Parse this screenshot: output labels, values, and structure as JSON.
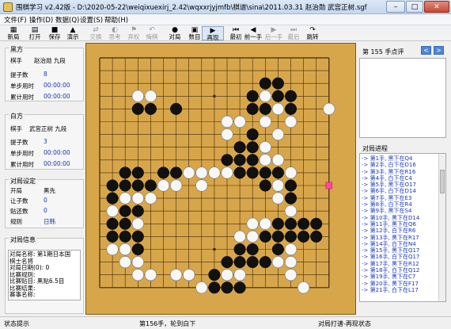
{
  "titlebar": {
    "title": "围棋学习 v2.42版 - D:\\2020-05-22\\weiqixuexirj_2.42\\wqxxrjyjmfb\\棋谱\\sina\\2011.03.31 赵治勋 武宫正树.sgf",
    "minimize": "–",
    "maximize": "□",
    "close": "✕"
  },
  "menu": [
    "文件(F)",
    "操作(D)",
    "数据(Q)",
    "设置(S)",
    "帮助(H)"
  ],
  "toolbar": [
    {
      "label": "新局",
      "icon": "▦",
      "state": "normal"
    },
    {
      "label": "打开",
      "icon": "▤",
      "state": "normal"
    },
    {
      "label": "保存",
      "icon": "■",
      "state": "normal"
    },
    {
      "label": "演示",
      "icon": "▲",
      "state": "normal"
    },
    {
      "label": "交换",
      "icon": "⇄",
      "state": "disabled"
    },
    {
      "label": "思考",
      "icon": "◐",
      "state": "disabled"
    },
    {
      "label": "弃权",
      "icon": "⚑",
      "state": "disabled"
    },
    {
      "label": "悔棋",
      "icon": "↶",
      "state": "disabled"
    },
    {
      "label": "对局",
      "icon": "●",
      "state": "normal"
    },
    {
      "label": "数目",
      "icon": "▣",
      "state": "normal"
    },
    {
      "label": "再现",
      "icon": "▶",
      "state": "pressed"
    },
    {
      "label": "最初",
      "icon": "⏮",
      "state": "normal"
    },
    {
      "label": "前一手",
      "icon": "◀",
      "state": "normal"
    },
    {
      "label": "后一手",
      "icon": "▶",
      "state": "disabled"
    },
    {
      "label": "最后",
      "icon": "⏭",
      "state": "disabled"
    },
    {
      "label": "跳转",
      "icon": "↷",
      "state": "normal"
    }
  ],
  "black": {
    "title": "黑方",
    "player_label": "棋手",
    "player": "赵治勋 九段",
    "captures_label": "提子数",
    "captures": "8",
    "time_per_move_label": "单步用时",
    "time_per_move": "00:00:00",
    "total_time_label": "累计用时",
    "total_time": "00:00:00"
  },
  "white": {
    "title": "白方",
    "player_label": "棋手",
    "player": "武宫正树 九段",
    "captures_label": "提子数",
    "captures": "3",
    "time_per_move_label": "单步用时",
    "time_per_move": "00:00:00",
    "total_time_label": "累计用时",
    "total_time": "00:00:00"
  },
  "settings": {
    "title": "对局设定",
    "first_label": "开局",
    "first": "黑先",
    "handicap_label": "让子数",
    "handicap": "0",
    "komi_label": "贴还数",
    "komi": "0",
    "rules_label": "规则",
    "rules": "日韩"
  },
  "game_info": {
    "title": "对局信息",
    "lines": [
      "对局名称: 第1期日本国",
      "棋士名将",
      "对局日期(0): 0",
      "比赛规则:",
      "比赛贴目: 黑贴6.5目",
      "比赛结果:",
      "赛事名称:"
    ]
  },
  "comment": {
    "title": "第 155 手点评",
    "prev": "<",
    "next": ">"
  },
  "process": {
    "title": "对局进程",
    "moves": [
      "-> 第1手, 黑下在Q4",
      "-> 第2手, 白下在D16",
      "-> 第3手, 黑下在R16",
      "-> 第4手, 白下在C4",
      "-> 第5手, 黑下在O17",
      "-> 第6手, 白下在D14",
      "-> 第7手, 黑下在E3",
      "-> 第8手, 白下在R4",
      "-> 第9手, 黑下在S4",
      "-> 第10手, 黑下在D14",
      "-> 第11手, 黑下在Q6",
      "-> 第12手, 白下在R6",
      "-> 第13手, 黑下在R17",
      "-> 第14手, 白下在N4",
      "-> 第15手, 黑下在Q17",
      "-> 第16手, 白下在Q17",
      "-> 第17手, 黑下在R12",
      "-> 第18手, 白下在Q12",
      "-> 第19手, 黑下在C7",
      "-> 第20手, 黑下在F17",
      "-> 第21手, 白下在L17"
    ]
  },
  "board": {
    "size": 19,
    "background": "#d8a64a",
    "rows": [
      "...................",
      "...................",
      ".............BB....",
      "...WW.......BWBB...",
      "...BB.B.....BBWB..W",
      "..........WW.W.W...",
      "..........W.B.W....",
      "...........BBW.....",
      "..........BBBWW....",
      "..BB.BBWWWWBBBBW...",
      ".BBBBWW.W....BWB...",
      ".BWWW.........WB...",
      ".WBB...........W...",
      ".BBW........WWBBBB.",
      ".BBB.......WWBBBBB.",
      ".WWB.......BB.BW...",
      "..WW......BBBBWW...",
      "...WW.WW.BWW...W...",
      "........WBBB....W.."
    ],
    "last_move": {
      "col": 18,
      "row": 10
    },
    "last_move_color": "#ff4aa0"
  },
  "status": {
    "left": "状态提示",
    "center": "第156手，轮到白下",
    "right": "对局打谱-再现状态"
  }
}
